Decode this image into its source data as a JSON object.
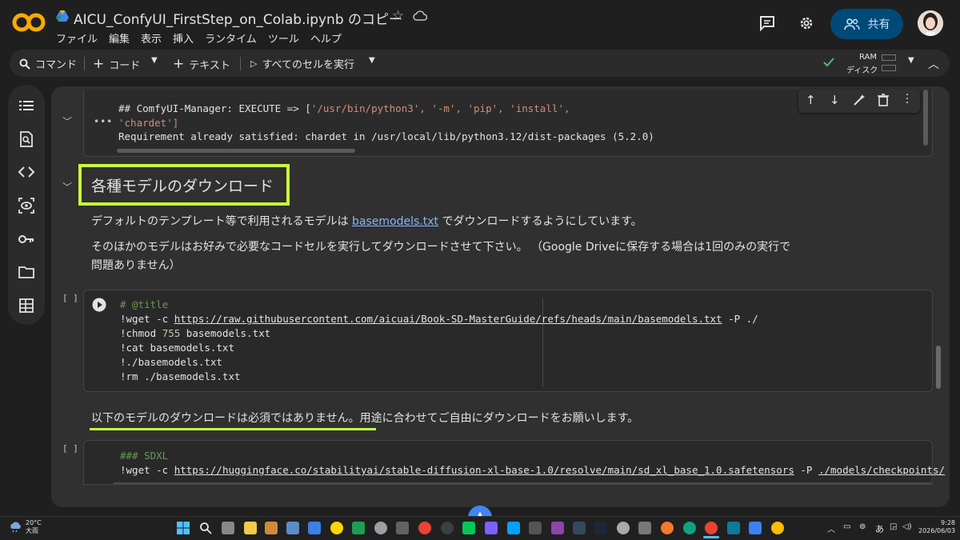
{
  "header": {
    "title": "AICU_ConfyUI_FirstStep_on_Colab.ipynb のコピー",
    "menu": [
      "ファイル",
      "編集",
      "表示",
      "挿入",
      "ランタイム",
      "ツール",
      "ヘルプ"
    ],
    "share_label": "共有"
  },
  "toolbar": {
    "command_label": "コマンド",
    "code_label": "コード",
    "text_label": "テキスト",
    "run_all_label": "すべてのセルを実行",
    "ram_label": "RAM",
    "disk_label": "ディスク"
  },
  "output_cell": {
    "line1_prefix": "## ComfyUI-Manager: EXECUTE => [",
    "line1_args": "'/usr/bin/python3', '-m', 'pip', 'install',",
    "line2": "'chardet']",
    "line3": "Requirement already satisfied: chardet in /usr/local/lib/python3.12/dist-packages (5.2.0)"
  },
  "section": {
    "heading": "各種モデルのダウンロード",
    "p1_before": "デフォルトのテンプレート等で利用されるモデルは",
    "p1_link": "basemodels.txt",
    "p1_after": "でダウンロードするようにしています。",
    "p2_line1": "そのほかのモデルはお好みで必要なコードセルを実行してダウンロードさせて下さい。 （Google Driveに保存する場合は1回のみの実行で",
    "p2_line2": "問題ありません）"
  },
  "code_cell1": {
    "bracket": "[ ]",
    "lines": {
      "l1": "# @title",
      "l2_cmd": "!wget -c ",
      "l2_url": "https://raw.githubusercontent.com/aicuai/Book-SD-MasterGuide/refs/heads/main/basemodels.txt",
      "l2_tail": " -P ./",
      "l3_a": "!chmod ",
      "l3_num": "755",
      "l3_b": " basemodels.txt",
      "l4": "!cat basemodels.txt",
      "l5": "!./basemodels.txt",
      "l6": "!rm ./basemodels.txt"
    }
  },
  "note": {
    "text": "以下のモデルのダウンロードは必須ではありません。用途に合わせてご自由にダウンロードをお願いします。"
  },
  "code_cell2": {
    "bracket": "[ ]",
    "l1": "### SDXL",
    "l2_cmd": "!wget -c ",
    "l2_url": "https://huggingface.co/stabilityai/stable-diffusion-xl-base-1.0/resolve/main/sd_xl_base_1.0.safetensors",
    "l2_mid": " -P ",
    "l2_path": "./models/checkpoints/"
  },
  "taskbar": {
    "weather_temp": "20°C",
    "weather_desc": "大雨",
    "time": "9:28",
    "date": "2026/06/03",
    "ime": "あ"
  },
  "colors": {
    "highlight": "#c6ff3a",
    "share_bg": "#004a77",
    "link": "#8ab4f8",
    "run_green": "#5bb974"
  }
}
